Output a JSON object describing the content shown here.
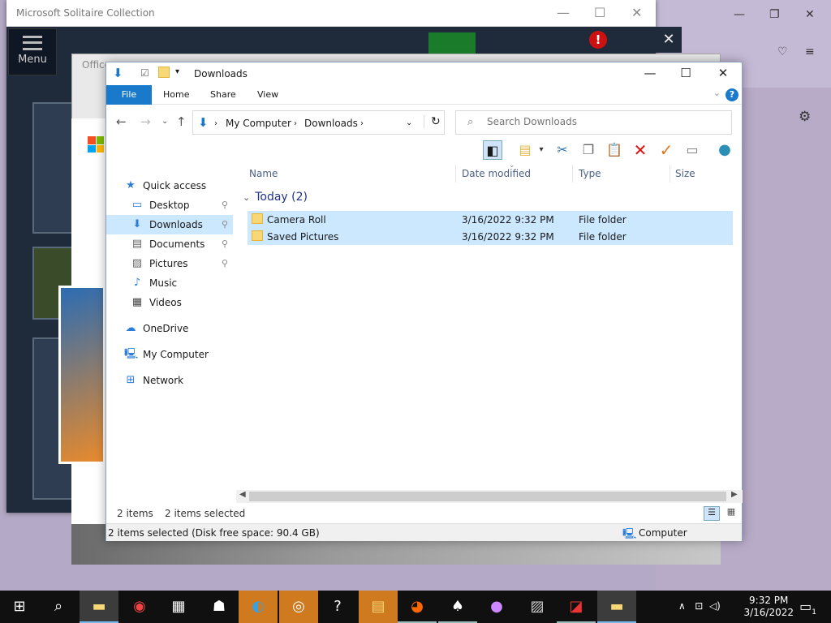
{
  "solitaire": {
    "title": "Microsoft Solitaire Collection",
    "menu_label": "Menu"
  },
  "office": {
    "title": "Office"
  },
  "explorer": {
    "title": "Downloads",
    "ribbon_tabs": [
      "File",
      "Home",
      "Share",
      "View"
    ],
    "address": {
      "root": "My Computer",
      "current": "Downloads"
    },
    "search_placeholder": "Search Downloads",
    "nav": [
      {
        "label": "Quick access",
        "icon": "star-icon",
        "level": "top"
      },
      {
        "label": "Desktop",
        "icon": "desktop-icon",
        "pinned": true
      },
      {
        "label": "Downloads",
        "icon": "download-icon",
        "pinned": true,
        "selected": true
      },
      {
        "label": "Documents",
        "icon": "documents-icon",
        "pinned": true
      },
      {
        "label": "Pictures",
        "icon": "pictures-icon",
        "pinned": true
      },
      {
        "label": "Music",
        "icon": "music-icon"
      },
      {
        "label": "Videos",
        "icon": "videos-icon"
      },
      {
        "label": "OneDrive",
        "icon": "cloud-icon",
        "level": "top"
      },
      {
        "label": "My Computer",
        "icon": "computer-icon",
        "level": "top"
      },
      {
        "label": "Network",
        "icon": "network-icon",
        "level": "top"
      }
    ],
    "columns": [
      "Name",
      "Date modified",
      "Type",
      "Size"
    ],
    "group": "Today (2)",
    "rows": [
      {
        "name": "Camera Roll",
        "date": "3/16/2022 9:32 PM",
        "type": "File folder"
      },
      {
        "name": "Saved Pictures",
        "date": "3/16/2022 9:32 PM",
        "type": "File folder"
      }
    ],
    "status": {
      "items": "2 items",
      "selected": "2 items selected"
    },
    "details_bar": {
      "text": "2 items selected (Disk free space: 90.4 GB)",
      "location": "Computer"
    }
  },
  "taskbar": {
    "time": "9:32 PM",
    "date": "3/16/2022",
    "notification_count": "1",
    "apps": [
      "windows-icon",
      "search-icon",
      "file-explorer-icon",
      "chrome-icon",
      "calculator-icon",
      "people-icon",
      "edge-icon",
      "groove-icon",
      "feedback-icon",
      "store-icon",
      "firefox-icon",
      "solitaire-icon",
      "paint3d-icon",
      "photos-icon",
      "office-icon",
      "explorer-window-icon"
    ]
  },
  "colors": {
    "accent": "#1979ca",
    "selection": "#cce8ff",
    "taskbar": "#101010"
  }
}
